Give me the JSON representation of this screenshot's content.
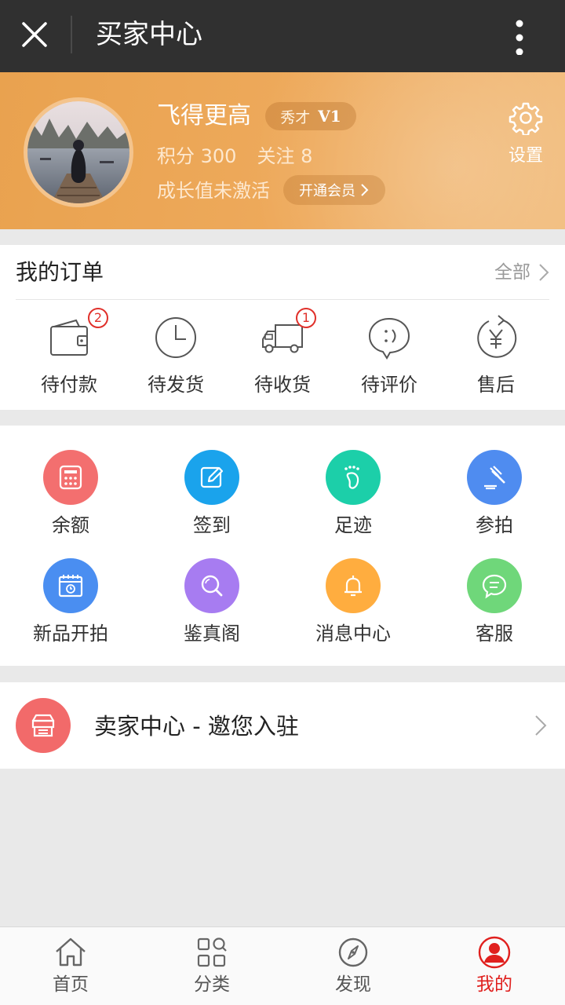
{
  "topbar": {
    "title": "买家中心"
  },
  "profile": {
    "username": "飞得更高",
    "rank_title": "秀才",
    "level": "V1",
    "points_text": "积分 300",
    "follow_text": "关注 8",
    "growth_text": "成长值未激活",
    "vip_button": "开通会员",
    "settings_label": "设置"
  },
  "orders": {
    "title": "我的订单",
    "all_label": "全部",
    "items": [
      {
        "label": "待付款",
        "icon": "wallet-icon",
        "badge": "2"
      },
      {
        "label": "待发货",
        "icon": "clock-icon",
        "badge": ""
      },
      {
        "label": "待收货",
        "icon": "truck-icon",
        "badge": "1"
      },
      {
        "label": "待评价",
        "icon": "comment-icon",
        "badge": ""
      },
      {
        "label": "售后",
        "icon": "refund-icon",
        "badge": ""
      }
    ]
  },
  "services": [
    {
      "label": "余额",
      "icon": "calculator-icon",
      "color": "#f36f6f"
    },
    {
      "label": "签到",
      "icon": "edit-icon",
      "color": "#1aa3ec"
    },
    {
      "label": "足迹",
      "icon": "footprint-icon",
      "color": "#1ccfa9"
    },
    {
      "label": "参拍",
      "icon": "gavel-icon",
      "color": "#4f8cf0"
    },
    {
      "label": "新品开拍",
      "icon": "calendar-icon",
      "color": "#4a8ef1"
    },
    {
      "label": "鉴真阁",
      "icon": "magnifier-icon",
      "color": "#a77cf1"
    },
    {
      "label": "消息中心",
      "icon": "bell-icon",
      "color": "#ffad3f"
    },
    {
      "label": "客服",
      "icon": "chat-icon",
      "color": "#6fd77a"
    }
  ],
  "seller": {
    "text": "卖家中心 - 邀您入驻"
  },
  "tabbar": {
    "items": [
      {
        "label": "首页",
        "icon": "home-icon"
      },
      {
        "label": "分类",
        "icon": "category-icon"
      },
      {
        "label": "发现",
        "icon": "compass-icon"
      },
      {
        "label": "我的",
        "icon": "user-icon"
      }
    ],
    "active_index": 3,
    "active_color": "#e0201e"
  }
}
